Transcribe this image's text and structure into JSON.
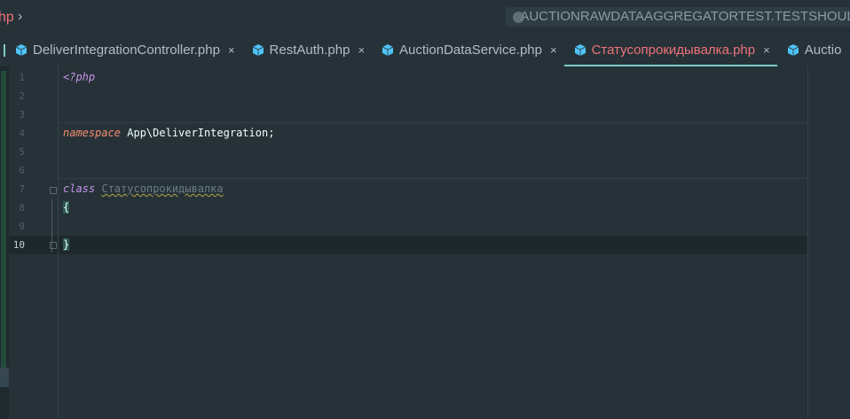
{
  "breadcrumb": {
    "file_fragment": "hp",
    "chevron": "›"
  },
  "run_config": {
    "label": "AUCTIONRAWDATAAGGREGATORTEST.TESTSHOULDGE",
    "icon": "test-config-icon"
  },
  "tabs": [
    {
      "label": "DeliverIntegrationController.php",
      "close": "×",
      "active": false,
      "icon": "php-file-icon"
    },
    {
      "label": "RestAuth.php",
      "close": "×",
      "active": false,
      "icon": "php-file-icon"
    },
    {
      "label": "AuctionDataService.php",
      "close": "×",
      "active": false,
      "icon": "php-file-icon"
    },
    {
      "label": "Статусопрокидывалка.php",
      "close": "×",
      "active": true,
      "icon": "php-file-icon"
    },
    {
      "label": "Auctio",
      "close": "",
      "active": false,
      "icon": "php-file-icon"
    }
  ],
  "colors": {
    "background": "#263238",
    "active_tab_text": "#f07178",
    "accent": "#80cbc4",
    "keyword": "#c792ea",
    "namespace_keyword": "#f78c6c",
    "php_icon": "#4fc3f7"
  },
  "editor": {
    "current_line": 10,
    "line_numbers": [
      "1",
      "2",
      "3",
      "4",
      "5",
      "6",
      "7",
      "8",
      "9",
      "10"
    ],
    "lines": {
      "l1": {
        "tag": "<?php"
      },
      "l4": {
        "keyword": "namespace",
        "rest": " App\\DeliverIntegration;"
      },
      "l7": {
        "keyword": "class",
        "name": "Статусопрокидывалка"
      },
      "l8": {
        "brace": "{"
      },
      "l10": {
        "brace": "}"
      }
    }
  }
}
